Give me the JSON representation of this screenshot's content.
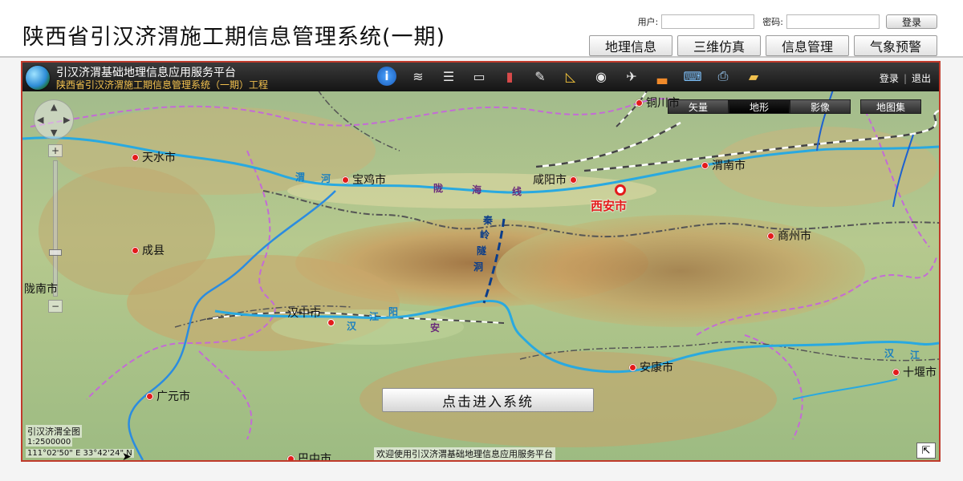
{
  "header": {
    "title": "陕西省引汉济渭施工期信息管理系统(一期)",
    "user_label": "用户:",
    "password_label": "密码:",
    "login_button": "登录",
    "nav_tabs": [
      "地理信息",
      "三维仿真",
      "信息管理",
      "气象预警"
    ]
  },
  "map": {
    "platform_title": "引汉济渭基础地理信息应用服务平台",
    "platform_subtitle": "陕西省引汉济渭施工期信息管理系统（一期）工程",
    "tools": [
      {
        "icon": "info-icon",
        "glyph": "i"
      },
      {
        "icon": "layers-icon",
        "glyph": "≋"
      },
      {
        "icon": "list-icon",
        "glyph": "☰"
      },
      {
        "icon": "monitor-icon",
        "glyph": "▭"
      },
      {
        "icon": "book-icon",
        "glyph": "▮"
      },
      {
        "icon": "pen-icon",
        "glyph": "✎"
      },
      {
        "icon": "ruler-icon",
        "glyph": "◺"
      },
      {
        "icon": "camera-icon",
        "glyph": "◉"
      },
      {
        "icon": "aircraft-icon",
        "glyph": "✈"
      },
      {
        "icon": "stamp-icon",
        "glyph": "▃"
      },
      {
        "icon": "computer-icon",
        "glyph": "⌨"
      },
      {
        "icon": "printer-icon",
        "glyph": "⎙"
      },
      {
        "icon": "folder-icon",
        "glyph": "▰"
      }
    ],
    "login_link": "登录",
    "logout_link": "退出",
    "layers": [
      "矢量",
      "地形",
      "影像"
    ],
    "active_layer": "地形",
    "map_collection": "地图集",
    "capital": "西安市",
    "cities": [
      "铜川市",
      "天水市",
      "宝鸡市",
      "咸阳市",
      "渭南市",
      "商州市",
      "成县",
      "陇南市",
      "汉中市",
      "安康市",
      "十堰市",
      "广元市",
      "巴中市"
    ],
    "route_chars": [
      "秦",
      "岭",
      "隧",
      "洞"
    ],
    "river_labels": [
      "渭",
      "河",
      "陇",
      "海",
      "线",
      "汉",
      "江",
      "阳",
      "安",
      "汉",
      "江"
    ],
    "enter_button": "点击进入系统",
    "overview_label": "引汉济渭全图",
    "scale": "1:2500000",
    "coordinates": "111°02'50\" E   33°42'24\" N",
    "welcome_text": "欢迎使用引汉济渭基础地理信息应用服务平台",
    "corner_icon": "expand-icon"
  },
  "colors": {
    "frame": "#c03a2b",
    "toolbar": "#1e1e1e",
    "city_dot": "#e31b1b",
    "river": "#29a9e0",
    "tunnel": "#0b3d8a",
    "boundary": "#c46bd6"
  }
}
